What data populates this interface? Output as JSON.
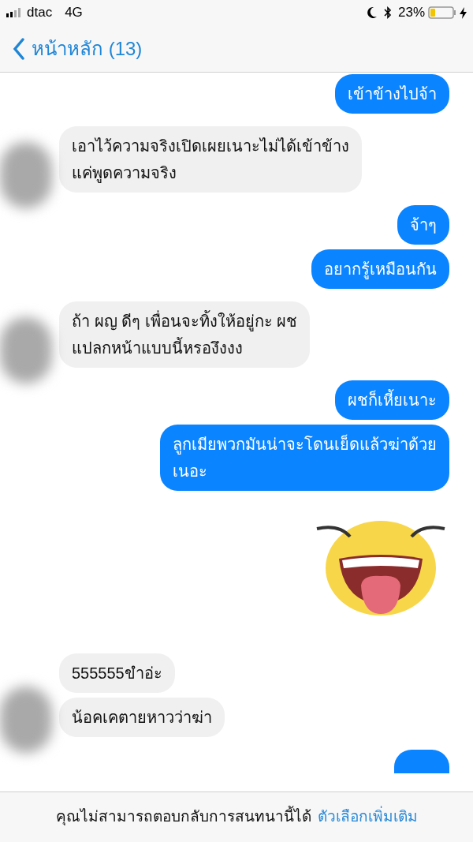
{
  "status_bar": {
    "carrier": "dtac",
    "network": "4G",
    "battery": "23%"
  },
  "nav": {
    "back_label": "หน้าหลัก (13)"
  },
  "groups": [
    {
      "kind": "outgoing",
      "messages": [
        {
          "kind": "text",
          "text": "เข้าข้างไปจ้า"
        }
      ]
    },
    {
      "kind": "incoming",
      "messages": [
        {
          "kind": "text",
          "text": "เอาไว้ความจริงเปิดเผยเนาะไม่ได้เข้าข้าง\nแค่พูดความจริง"
        }
      ]
    },
    {
      "kind": "outgoing",
      "messages": [
        {
          "kind": "text",
          "text": "จ้าๆ"
        },
        {
          "kind": "text",
          "text": "อยากรู้เหมือนกัน"
        }
      ]
    },
    {
      "kind": "incoming",
      "messages": [
        {
          "kind": "text",
          "text": "ถ้า ผญ ดีๆ เพื่อนจะทิ้งให้อยู่กะ ผช\nแปลกหน้าแบบนี้หรองึงงง"
        }
      ]
    },
    {
      "kind": "outgoing",
      "messages": [
        {
          "kind": "text",
          "text": "ผชก็เหี้ยเนาะ"
        },
        {
          "kind": "text",
          "text": "ลูกเมียพวกมันน่าจะโดนเย็ดแล้วฆ่าด้วย\nเนอะ"
        },
        {
          "kind": "sticker"
        }
      ]
    },
    {
      "kind": "incoming",
      "messages": [
        {
          "kind": "text",
          "text": "555555ขำอ่ะ"
        },
        {
          "kind": "text",
          "text": "น้อคเคตายหาวว่าฆ่า"
        }
      ]
    },
    {
      "kind": "outgoing",
      "messages": [
        {
          "kind": "cut"
        }
      ]
    }
  ],
  "footer": {
    "notice": "คุณไม่สามารถตอบกลับการสนทนานี้ได้",
    "link": "ตัวเลือกเพิ่มเติม"
  }
}
